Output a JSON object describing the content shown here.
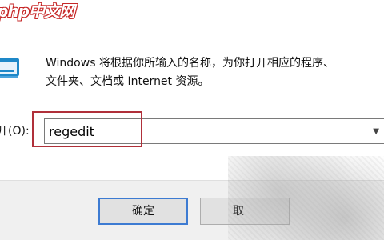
{
  "watermark": {
    "text": "php中文网"
  },
  "run_dialog": {
    "description_line1": "Windows 将根据你所输入的名称，为你打开相应的程序、",
    "description_line2": "文件夹、文档或 Internet 资源。",
    "open_label": "开(O):",
    "command_value": "regedit",
    "ok_label": "确定",
    "cancel_label": "取"
  },
  "colors": {
    "highlight_border": "#b0303a",
    "default_button_border": "#3d7bd2",
    "button_bar_bg": "#f0f0f0"
  },
  "icons": {
    "run": "run-dialog-icon",
    "dropdown": "chevron-down-icon"
  }
}
